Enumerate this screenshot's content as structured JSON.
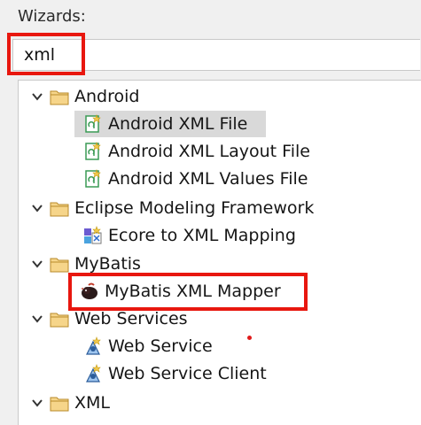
{
  "header": {
    "label": "Wizards:"
  },
  "filter": {
    "value": "xml"
  },
  "tree": {
    "android": {
      "label": "Android",
      "items": [
        "Android XML File",
        "Android XML Layout File",
        "Android XML Values File"
      ]
    },
    "emf": {
      "label": "Eclipse Modeling Framework",
      "items": [
        "Ecore to XML Mapping"
      ]
    },
    "mybatis": {
      "label": "MyBatis",
      "items": [
        "MyBatis XML Mapper"
      ]
    },
    "webservices": {
      "label": "Web Services",
      "items": [
        "Web Service",
        "Web Service Client"
      ]
    },
    "xml": {
      "label": "XML"
    }
  },
  "colors": {
    "highlight": "#e8170f",
    "selection": "#d9d9d9",
    "folder": "#e8b84a"
  }
}
